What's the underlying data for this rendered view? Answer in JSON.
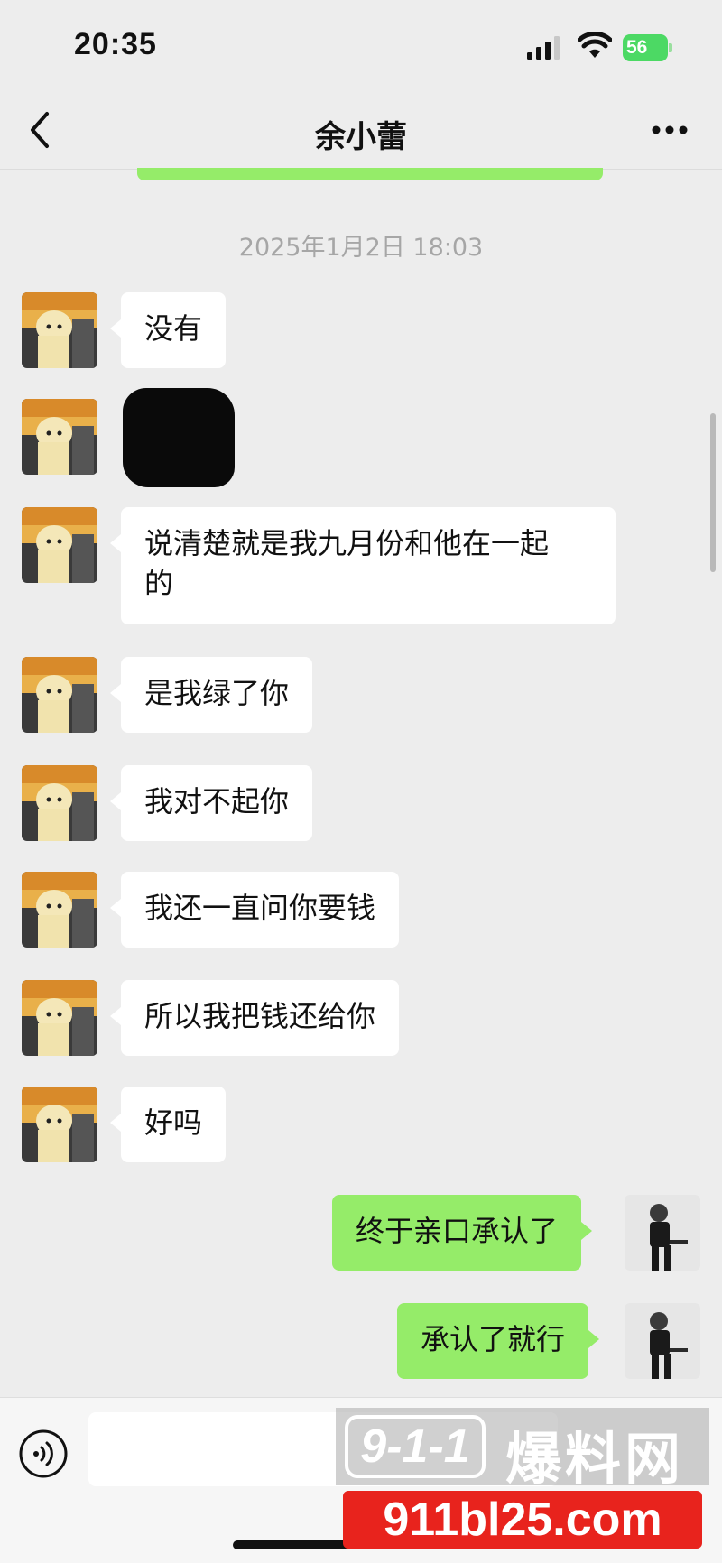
{
  "status_bar": {
    "time": "20:35",
    "battery_level": "56",
    "icons": [
      "signal-icon",
      "wifi-icon",
      "battery-charging-icon"
    ]
  },
  "nav": {
    "title": "余小蕾",
    "back_icon": "chevron-left-icon",
    "more_icon": "more-dots-icon"
  },
  "chat": {
    "timestamp": "2025年1月2日 18:03",
    "messages": [
      {
        "side": "left",
        "text": "没有"
      },
      {
        "side": "left",
        "text": "",
        "redacted": true
      },
      {
        "side": "left",
        "text_lines": [
          "说清楚就是我九月份和他在一起",
          "的"
        ]
      },
      {
        "side": "left",
        "text": "是我绿了你"
      },
      {
        "side": "left",
        "text": "我对不起你"
      },
      {
        "side": "left",
        "text": "我还一直问你要钱"
      },
      {
        "side": "left",
        "text": "所以我把钱还给你"
      },
      {
        "side": "left",
        "text": "好吗"
      },
      {
        "side": "right",
        "text": "终于亲口承认了"
      },
      {
        "side": "right",
        "text": "承认了就行"
      }
    ]
  },
  "input_bar": {
    "voice_icon": "voice-icon",
    "input_value": ""
  },
  "watermark": {
    "badge": "9-1-1",
    "name": "爆料网",
    "url": "911bl25.com"
  },
  "colors": {
    "background": "#ededed",
    "bubble_incoming": "#ffffff",
    "bubble_outgoing": "#95ec69",
    "timestamp": "#a6a6a6",
    "watermark_red": "#e8231d"
  }
}
